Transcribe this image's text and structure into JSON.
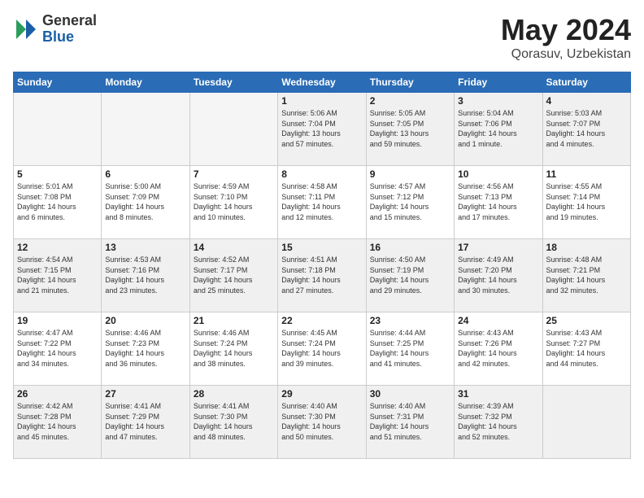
{
  "header": {
    "logo_general": "General",
    "logo_blue": "Blue",
    "month_title": "May 2024",
    "location": "Qorasuv, Uzbekistan"
  },
  "calendar": {
    "weekdays": [
      "Sunday",
      "Monday",
      "Tuesday",
      "Wednesday",
      "Thursday",
      "Friday",
      "Saturday"
    ],
    "weeks": [
      [
        {
          "day": "",
          "info": ""
        },
        {
          "day": "",
          "info": ""
        },
        {
          "day": "",
          "info": ""
        },
        {
          "day": "1",
          "info": "Sunrise: 5:06 AM\nSunset: 7:04 PM\nDaylight: 13 hours\nand 57 minutes."
        },
        {
          "day": "2",
          "info": "Sunrise: 5:05 AM\nSunset: 7:05 PM\nDaylight: 13 hours\nand 59 minutes."
        },
        {
          "day": "3",
          "info": "Sunrise: 5:04 AM\nSunset: 7:06 PM\nDaylight: 14 hours\nand 1 minute."
        },
        {
          "day": "4",
          "info": "Sunrise: 5:03 AM\nSunset: 7:07 PM\nDaylight: 14 hours\nand 4 minutes."
        }
      ],
      [
        {
          "day": "5",
          "info": "Sunrise: 5:01 AM\nSunset: 7:08 PM\nDaylight: 14 hours\nand 6 minutes."
        },
        {
          "day": "6",
          "info": "Sunrise: 5:00 AM\nSunset: 7:09 PM\nDaylight: 14 hours\nand 8 minutes."
        },
        {
          "day": "7",
          "info": "Sunrise: 4:59 AM\nSunset: 7:10 PM\nDaylight: 14 hours\nand 10 minutes."
        },
        {
          "day": "8",
          "info": "Sunrise: 4:58 AM\nSunset: 7:11 PM\nDaylight: 14 hours\nand 12 minutes."
        },
        {
          "day": "9",
          "info": "Sunrise: 4:57 AM\nSunset: 7:12 PM\nDaylight: 14 hours\nand 15 minutes."
        },
        {
          "day": "10",
          "info": "Sunrise: 4:56 AM\nSunset: 7:13 PM\nDaylight: 14 hours\nand 17 minutes."
        },
        {
          "day": "11",
          "info": "Sunrise: 4:55 AM\nSunset: 7:14 PM\nDaylight: 14 hours\nand 19 minutes."
        }
      ],
      [
        {
          "day": "12",
          "info": "Sunrise: 4:54 AM\nSunset: 7:15 PM\nDaylight: 14 hours\nand 21 minutes."
        },
        {
          "day": "13",
          "info": "Sunrise: 4:53 AM\nSunset: 7:16 PM\nDaylight: 14 hours\nand 23 minutes."
        },
        {
          "day": "14",
          "info": "Sunrise: 4:52 AM\nSunset: 7:17 PM\nDaylight: 14 hours\nand 25 minutes."
        },
        {
          "day": "15",
          "info": "Sunrise: 4:51 AM\nSunset: 7:18 PM\nDaylight: 14 hours\nand 27 minutes."
        },
        {
          "day": "16",
          "info": "Sunrise: 4:50 AM\nSunset: 7:19 PM\nDaylight: 14 hours\nand 29 minutes."
        },
        {
          "day": "17",
          "info": "Sunrise: 4:49 AM\nSunset: 7:20 PM\nDaylight: 14 hours\nand 30 minutes."
        },
        {
          "day": "18",
          "info": "Sunrise: 4:48 AM\nSunset: 7:21 PM\nDaylight: 14 hours\nand 32 minutes."
        }
      ],
      [
        {
          "day": "19",
          "info": "Sunrise: 4:47 AM\nSunset: 7:22 PM\nDaylight: 14 hours\nand 34 minutes."
        },
        {
          "day": "20",
          "info": "Sunrise: 4:46 AM\nSunset: 7:23 PM\nDaylight: 14 hours\nand 36 minutes."
        },
        {
          "day": "21",
          "info": "Sunrise: 4:46 AM\nSunset: 7:24 PM\nDaylight: 14 hours\nand 38 minutes."
        },
        {
          "day": "22",
          "info": "Sunrise: 4:45 AM\nSunset: 7:24 PM\nDaylight: 14 hours\nand 39 minutes."
        },
        {
          "day": "23",
          "info": "Sunrise: 4:44 AM\nSunset: 7:25 PM\nDaylight: 14 hours\nand 41 minutes."
        },
        {
          "day": "24",
          "info": "Sunrise: 4:43 AM\nSunset: 7:26 PM\nDaylight: 14 hours\nand 42 minutes."
        },
        {
          "day": "25",
          "info": "Sunrise: 4:43 AM\nSunset: 7:27 PM\nDaylight: 14 hours\nand 44 minutes."
        }
      ],
      [
        {
          "day": "26",
          "info": "Sunrise: 4:42 AM\nSunset: 7:28 PM\nDaylight: 14 hours\nand 45 minutes."
        },
        {
          "day": "27",
          "info": "Sunrise: 4:41 AM\nSunset: 7:29 PM\nDaylight: 14 hours\nand 47 minutes."
        },
        {
          "day": "28",
          "info": "Sunrise: 4:41 AM\nSunset: 7:30 PM\nDaylight: 14 hours\nand 48 minutes."
        },
        {
          "day": "29",
          "info": "Sunrise: 4:40 AM\nSunset: 7:30 PM\nDaylight: 14 hours\nand 50 minutes."
        },
        {
          "day": "30",
          "info": "Sunrise: 4:40 AM\nSunset: 7:31 PM\nDaylight: 14 hours\nand 51 minutes."
        },
        {
          "day": "31",
          "info": "Sunrise: 4:39 AM\nSunset: 7:32 PM\nDaylight: 14 hours\nand 52 minutes."
        },
        {
          "day": "",
          "info": ""
        }
      ]
    ]
  }
}
